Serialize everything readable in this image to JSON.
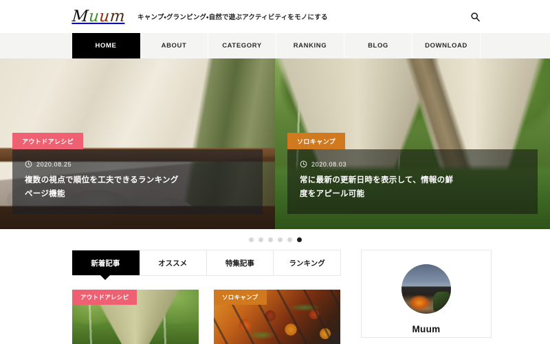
{
  "header": {
    "logo": {
      "part1": "M",
      "part2": "u",
      "part3": "u",
      "part4": "m"
    },
    "tagline": "キャンプ・グランピング・自然で遊ぶアクティビティをモノにする",
    "search_icon": "search-icon"
  },
  "nav": {
    "items": [
      {
        "label": "HOME",
        "active": true
      },
      {
        "label": "ABOUT",
        "active": false
      },
      {
        "label": "CATEGORY",
        "active": false
      },
      {
        "label": "RANKING",
        "active": false
      },
      {
        "label": "BLOG",
        "active": false
      },
      {
        "label": "DOWNLOAD",
        "active": false
      }
    ]
  },
  "hero": {
    "slides": [
      {
        "category": "アウトドアレシピ",
        "category_color": "#ee6072",
        "date": "2020.08.25",
        "title": "複数の視点で順位を工夫できるランキングページ機能",
        "image_alt": "glamping-tent-interior-bed"
      },
      {
        "category": "ソロキャンプ",
        "category_color": "#d0791f",
        "date": "2020.08.03",
        "title": "常に最新の更新日時を表示して、情報の鮮度をアピール可能",
        "image_alt": "bell-tents-birch-forest"
      }
    ],
    "dots": {
      "count": 6,
      "active_index": 5
    }
  },
  "main": {
    "tabs": [
      {
        "label": "新着記事",
        "active": true
      },
      {
        "label": "オススメ",
        "active": false
      },
      {
        "label": "特集記事",
        "active": false
      },
      {
        "label": "ランキング",
        "active": false
      }
    ],
    "articles": [
      {
        "category": "アウトドアレシピ",
        "category_color": "#ee6072",
        "image_alt": "tarp-tent-in-forest"
      },
      {
        "category": "ソロキャンプ",
        "category_color": "#d0791f",
        "image_alt": "grilled-vegetable-skewers"
      }
    ]
  },
  "sidebar": {
    "profile": {
      "name": "Muum",
      "avatar_alt": "campfire-mountain-night"
    }
  },
  "colors": {
    "accent_pink": "#ee6072",
    "accent_orange": "#d0791f",
    "active_black": "#000000",
    "nav_bg": "#f4f4f2",
    "border": "#e7e7e7"
  }
}
